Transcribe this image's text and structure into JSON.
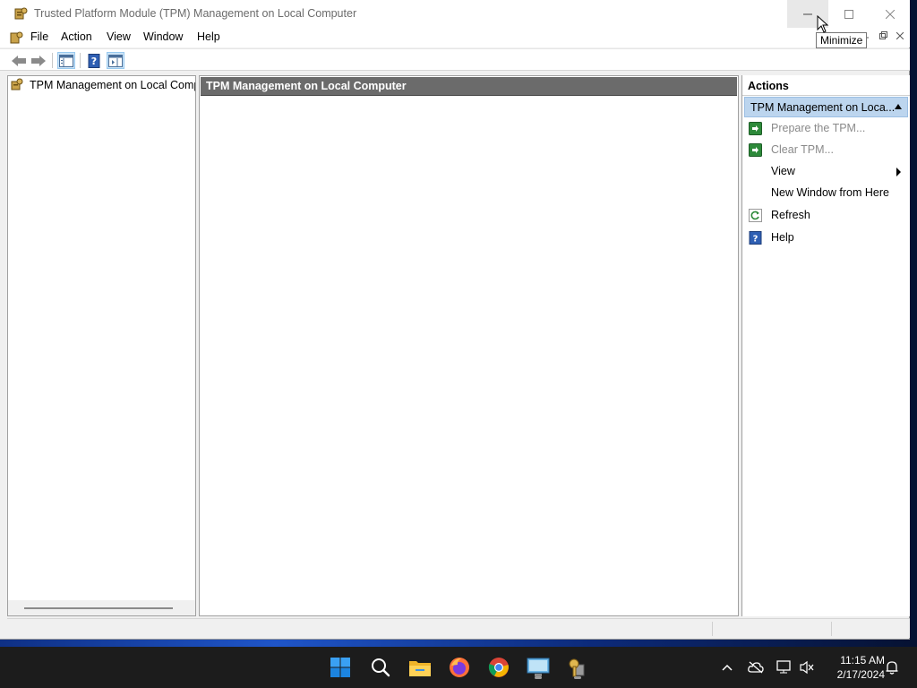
{
  "window": {
    "title": "Trusted Platform Module (TPM) Management on Local Computer",
    "tooltip": "Minimize"
  },
  "menu": {
    "items": [
      "File",
      "Action",
      "View",
      "Window",
      "Help"
    ]
  },
  "tree": {
    "root_label": "TPM Management on Local Comp"
  },
  "center": {
    "header": "TPM Management on Local Computer"
  },
  "actions": {
    "header": "Actions",
    "group": "TPM Management on Loca...",
    "items": [
      {
        "label": "Prepare the TPM...",
        "icon": "green-arrow-icon",
        "enabled": false
      },
      {
        "label": "Clear TPM...",
        "icon": "green-arrow-icon",
        "enabled": false
      },
      {
        "label": "View",
        "icon": "",
        "enabled": true,
        "submenu": true
      },
      {
        "label": "New Window from Here",
        "icon": "",
        "enabled": true
      },
      {
        "label": "Refresh",
        "icon": "refresh-icon",
        "enabled": true
      },
      {
        "label": "Help",
        "icon": "help-icon",
        "enabled": true
      }
    ]
  },
  "taskbar": {
    "time": "11:15 AM",
    "date": "2/17/2024",
    "apps": [
      "start-icon",
      "search-icon",
      "file-explorer-icon",
      "firefox-icon",
      "chrome-icon",
      "remote-desktop-icon",
      "tpm-icon"
    ]
  },
  "colors": {
    "center_header_bg": "#6b6b6b",
    "actions_group_bg": "#bcd5ee",
    "taskbar_bg": "#1c1c1c"
  }
}
